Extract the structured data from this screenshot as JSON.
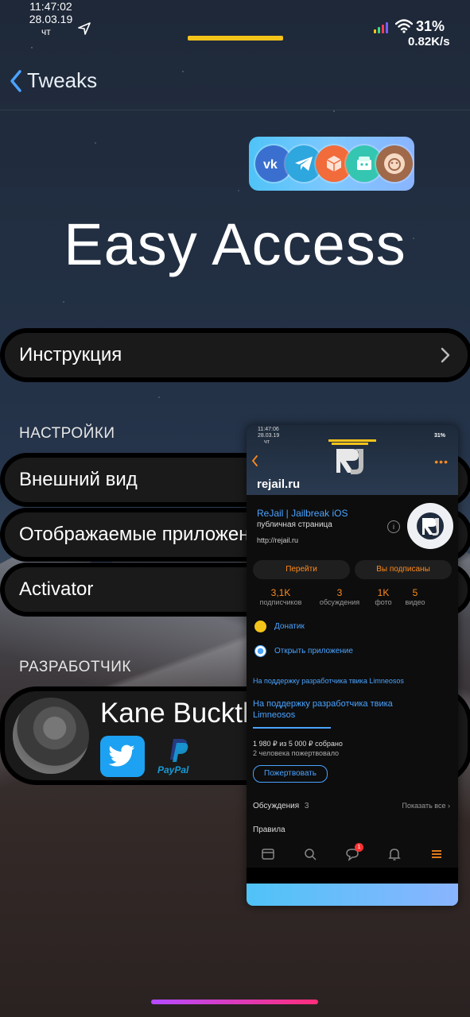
{
  "status": {
    "time": "11:47:02",
    "date": "28.03.19",
    "day": "чт",
    "battery": "31%",
    "speed": "0.82K/s",
    "colors": {
      "notch_bar": "#f5c41a"
    }
  },
  "nav": {
    "back_label": "Tweaks",
    "accent": "#4aa3ff"
  },
  "app_icons": [
    "vk-icon",
    "telegram-icon",
    "cydia-icon",
    "box-icon",
    "avatar-icon"
  ],
  "app_title": "Easy Access",
  "menu": {
    "instruction": "Инструкция"
  },
  "settings": {
    "header": "НАСТРОЙКИ",
    "items": [
      {
        "label": "Внешний вид"
      },
      {
        "label": "Отображаемые приложения"
      },
      {
        "label": "Activator"
      }
    ]
  },
  "developer": {
    "header": "РАЗРАБОТЧИК",
    "name": "Kane Buckthorne",
    "paypal_label": "PayPal"
  },
  "overlay": {
    "time": "11:47:06",
    "date": "28.03.19",
    "day": "чт",
    "battery": "31%",
    "site": "rejail.ru",
    "group_name": "ReJail | Jailbreak iOS",
    "group_type": "публичная страница",
    "group_url": "http://rejail.ru",
    "btn_go": "Перейти",
    "btn_subscribed": "Вы подписаны",
    "stats": [
      {
        "value": "3,1K",
        "label": "подписчиков"
      },
      {
        "value": "3",
        "label": "обсуждения"
      },
      {
        "value": "1K",
        "label": "фото"
      },
      {
        "value": "5",
        "label": "видео"
      }
    ],
    "link_donate": "Донатик",
    "link_open_app": "Открыть приложение",
    "support_small": "На поддержку разработчика твика Limneosos",
    "support_title": "На поддержку разработчика твика Limneosos",
    "raised": "1 980 ₽ из 5 000 ₽ собрано",
    "donors": "2 человека пожертвовало",
    "donate_button": "Пожертвовать",
    "discussions_label": "Обсуждения",
    "discussions_count": "3",
    "show_all": "Показать все",
    "rules": "Правила",
    "badge_count": "1",
    "accent_orange": "#ff8a1c",
    "accent_blue": "#4aa3ff"
  }
}
